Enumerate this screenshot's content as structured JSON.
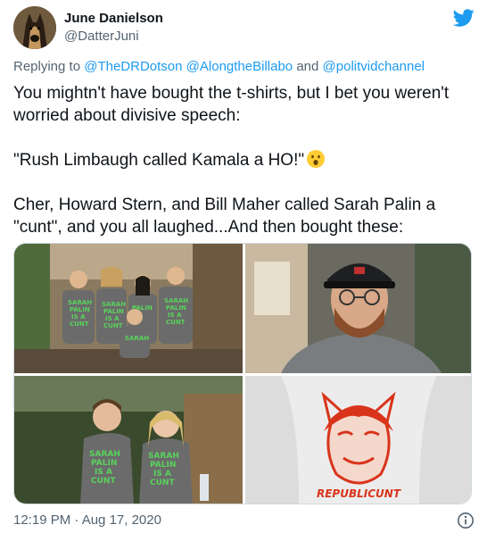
{
  "author": {
    "name": "June Danielson",
    "handle": "@DatterJuni",
    "avatar_icon": "dog-avatar-icon"
  },
  "platform_icon": "twitter-bird-icon",
  "reply": {
    "prefix": "Replying to",
    "mentions": [
      "@TheDRDotson",
      "@AlongtheBillabo"
    ],
    "joiner": "and",
    "last_mention": "@politvidchannel"
  },
  "tweet": {
    "line1": "You mightn't have bought the t-shirts, but I bet you weren't worried about divisive speech:",
    "line2": "\"Rush Limbaugh called Kamala a HO!\"",
    "line2_emoji": "astonished-face-emoji",
    "line3": "Cher, Howard Stern, and Bill Maher called Sarah Palin a \"cunt\", and you all laughed...And then bought these:"
  },
  "photos": {
    "p1_shirt_text": [
      "SARAH",
      "PALIN",
      "IS A",
      "CUNT"
    ],
    "p3_shirt_text": [
      "SARAH",
      "PALIN",
      "IS A",
      "CUNT"
    ],
    "p4_shirt_caption": "REPUBLICUNT"
  },
  "footer": {
    "timestamp": "12:19 PM · Aug 17, 2020",
    "info_icon": "info-icon"
  },
  "colors": {
    "link": "#1d9bf0",
    "secondary_text": "#536471",
    "primary_text": "#0f1419"
  }
}
